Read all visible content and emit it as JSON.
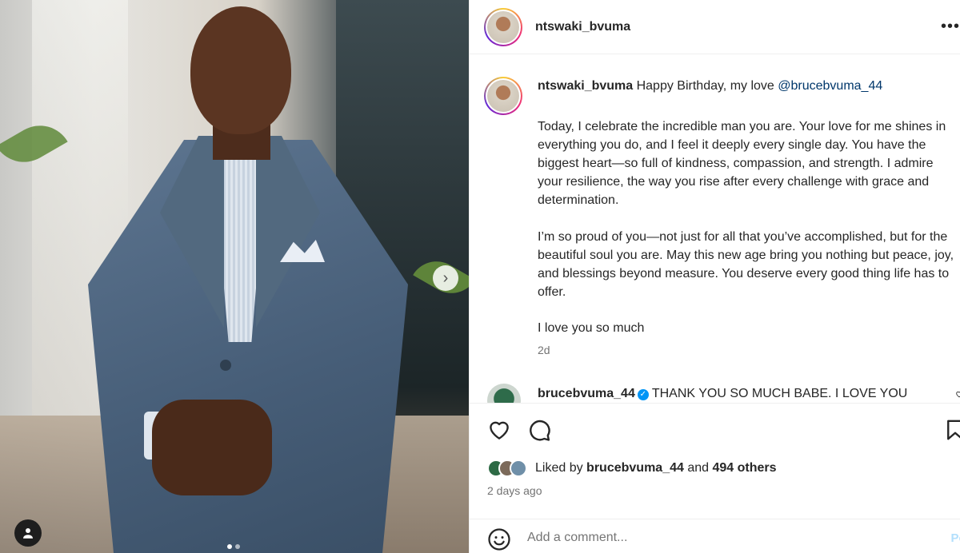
{
  "post": {
    "username": "ntswaki_bvuma",
    "more_label": "•••"
  },
  "caption": {
    "username": "ntswaki_bvuma",
    "intro": " Happy Birthday, my love ",
    "mention": "@brucebvuma_44",
    "paragraph1": "Today, I celebrate the incredible man you are. Your love for me shines in everything you do, and I feel it deeply every single day. You have the biggest heart—so full of kindness, compassion, and strength. I admire your resilience, the way you rise after every challenge with grace and determination.",
    "paragraph2": "I’m so proud of you—not just for all that you’ve accomplished, but for the beautiful soul you are. May this new age bring you nothing but peace, joy, and blessings beyond measure. You deserve every good thing life has to offer.",
    "paragraph3": "I love you so much",
    "time": "2d"
  },
  "reply": {
    "username": "brucebvuma_44",
    "text": "THANK YOU SO MUCH BABE. I LOVE YOU"
  },
  "likes": {
    "prefix": "Liked by ",
    "user": "brucebvuma_44",
    "and": " and ",
    "others": "494 others"
  },
  "posted_ago": "2 days ago",
  "comment_box": {
    "placeholder": "Add a comment...",
    "post_label": "Post"
  },
  "carousel": {
    "next_label": "›",
    "slide_count": 2,
    "active_index": 0
  },
  "colors": {
    "mention": "#00376b",
    "verified": "#0095f6",
    "muted": "#737373"
  }
}
